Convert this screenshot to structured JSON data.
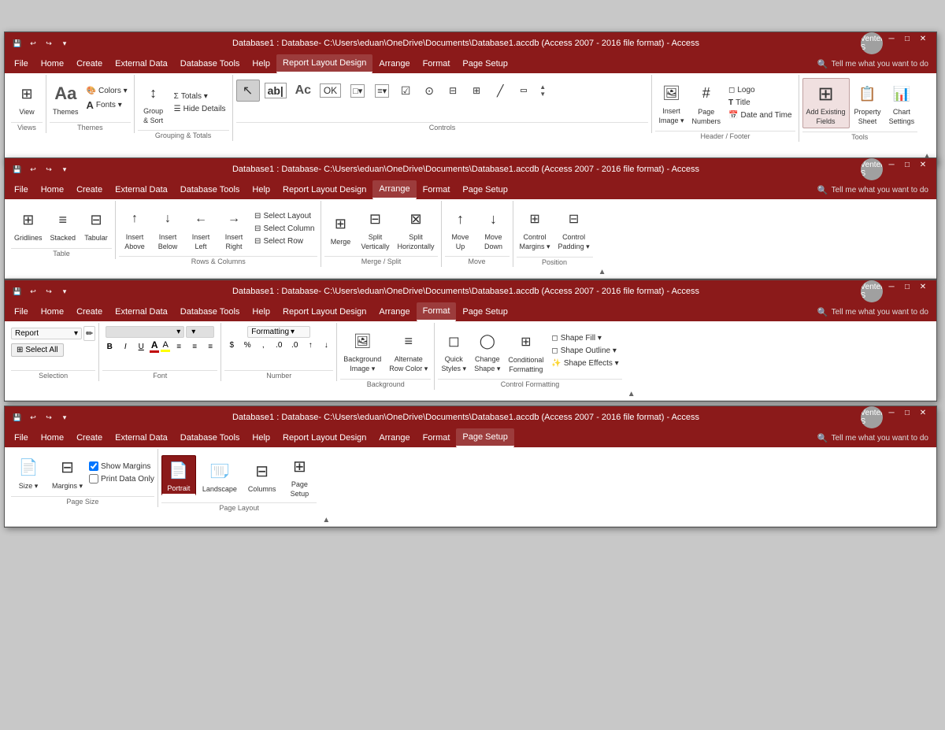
{
  "windows": [
    {
      "id": "window1",
      "title": "Database1 : Database- C:\\Users\\eduan\\OneDrive\\Documents\\Database1.accdb (Access 2007 - 2016 file format) - Access",
      "active_tab": "Report Layout Design",
      "tabs": [
        "File",
        "Home",
        "Create",
        "External Data",
        "Database Tools",
        "Help",
        "Report Layout Design",
        "Arrange",
        "Format",
        "Page Setup"
      ],
      "ribbon_name": "Report Layout Design",
      "sections": [
        {
          "name": "Views",
          "items": [
            {
              "label": "View",
              "icon": "⊞"
            }
          ]
        },
        {
          "name": "Themes",
          "items": [
            {
              "label": "Themes",
              "icon": "Aa"
            },
            {
              "label": "Colors",
              "icon": "🎨"
            },
            {
              "label": "Fonts",
              "icon": "A"
            }
          ]
        },
        {
          "name": "Grouping & Totals",
          "items": [
            {
              "label": "Group & Sort",
              "icon": "↕"
            },
            {
              "label": "Totals",
              "icon": "Σ"
            },
            {
              "label": "Hide Details",
              "icon": "≡"
            }
          ]
        },
        {
          "name": "Controls",
          "items": []
        },
        {
          "name": "Header / Footer",
          "items": [
            {
              "label": "Insert Image",
              "icon": "🖼"
            },
            {
              "label": "Page Numbers",
              "icon": "#"
            },
            {
              "label": "Logo",
              "icon": "◻"
            },
            {
              "label": "Title",
              "icon": "T"
            },
            {
              "label": "Date and Time",
              "icon": "📅"
            }
          ]
        },
        {
          "name": "Tools",
          "items": [
            {
              "label": "Add Existing Fields",
              "icon": "⊞"
            },
            {
              "label": "Property Sheet",
              "icon": "📋"
            },
            {
              "label": "Chart Settings",
              "icon": "📊"
            }
          ]
        }
      ]
    },
    {
      "id": "window2",
      "title": "Database1 : Database- C:\\Users\\eduan\\OneDrive\\Documents\\Database1.accdb (Access 2007 - 2016 file format) - Access",
      "active_tab": "Arrange",
      "tabs": [
        "File",
        "Home",
        "Create",
        "External Data",
        "Database Tools",
        "Help",
        "Report Layout Design",
        "Arrange",
        "Format",
        "Page Setup"
      ],
      "ribbon_name": "Arrange",
      "sections": [
        {
          "name": "Table",
          "items": [
            {
              "label": "Gridlines",
              "icon": "⊞"
            },
            {
              "label": "Stacked",
              "icon": "≡"
            },
            {
              "label": "Tabular",
              "icon": "⊟"
            }
          ]
        },
        {
          "name": "Rows & Columns",
          "items": [
            {
              "label": "Insert Above",
              "icon": "↑"
            },
            {
              "label": "Insert Below",
              "icon": "↓"
            },
            {
              "label": "Insert Left",
              "icon": "←"
            },
            {
              "label": "Insert Right",
              "icon": "→"
            },
            {
              "label": "Select Layout",
              "icon": ""
            },
            {
              "label": "Select Column",
              "icon": ""
            },
            {
              "label": "Select Row",
              "icon": ""
            }
          ]
        },
        {
          "name": "Merge / Split",
          "items": [
            {
              "label": "Merge",
              "icon": "⊞"
            },
            {
              "label": "Split Vertically",
              "icon": "⊟"
            },
            {
              "label": "Split Horizontally",
              "icon": "⊠"
            }
          ]
        },
        {
          "name": "Move",
          "items": [
            {
              "label": "Move Up",
              "icon": "↑"
            },
            {
              "label": "Move Down",
              "icon": "↓"
            }
          ]
        },
        {
          "name": "Position",
          "items": [
            {
              "label": "Control Margins",
              "icon": "⊞"
            },
            {
              "label": "Control Padding",
              "icon": "⊟"
            }
          ]
        }
      ]
    },
    {
      "id": "window3",
      "title": "Database1 : Database- C:\\Users\\eduan\\OneDrive\\Documents\\Database1.accdb (Access 2007 - 2016 file format) - Access",
      "active_tab": "Format",
      "tabs": [
        "File",
        "Home",
        "Create",
        "External Data",
        "Database Tools",
        "Help",
        "Report Layout Design",
        "Arrange",
        "Format",
        "Page Setup"
      ],
      "ribbon_name": "Format",
      "sections": [
        {
          "name": "Selection",
          "items": [
            {
              "label": "Report",
              "dropdown": true
            },
            {
              "label": "Select All",
              "icon": "⊞"
            }
          ]
        },
        {
          "name": "Font",
          "items": [
            {
              "label": "B",
              "bold": true
            },
            {
              "label": "I",
              "italic": true
            },
            {
              "label": "U",
              "underline": true
            },
            {
              "label": "Font Color",
              "icon": "A"
            },
            {
              "label": "Highlight",
              "icon": "✏"
            }
          ]
        },
        {
          "name": "Number",
          "items": []
        },
        {
          "name": "Background",
          "items": [
            {
              "label": "Background Image",
              "icon": "🖼"
            },
            {
              "label": "Alternate Row Color",
              "icon": "🎨"
            }
          ]
        },
        {
          "name": "Control Formatting",
          "items": [
            {
              "label": "Quick Styles",
              "icon": "◻"
            },
            {
              "label": "Change Shape",
              "icon": "◯"
            },
            {
              "label": "Conditional Formatting",
              "icon": "⊞"
            },
            {
              "label": "Shape Fill",
              "icon": "◻"
            },
            {
              "label": "Shape Outline",
              "icon": "◻"
            },
            {
              "label": "Shape Effects",
              "icon": "✨"
            }
          ]
        }
      ]
    },
    {
      "id": "window4",
      "title": "Database1 : Database- C:\\Users\\eduan\\OneDrive\\Documents\\Database1.accdb (Access 2007 - 2016 file format) - Access",
      "active_tab": "Page Setup",
      "tabs": [
        "File",
        "Home",
        "Create",
        "External Data",
        "Database Tools",
        "Help",
        "Report Layout Design",
        "Arrange",
        "Format",
        "Page Setup"
      ],
      "ribbon_name": "Page Setup",
      "sections": [
        {
          "name": "Page Size",
          "items": [
            {
              "label": "Size",
              "icon": "📄"
            },
            {
              "label": "Margins",
              "icon": "⊟"
            },
            {
              "label": "Show Margins",
              "checkbox": true
            },
            {
              "label": "Print Data Only",
              "checkbox": true
            }
          ]
        },
        {
          "name": "Page Layout",
          "items": [
            {
              "label": "Portrait",
              "icon": "📄",
              "active": true
            },
            {
              "label": "Landscape",
              "icon": "📄"
            },
            {
              "label": "Columns",
              "icon": "⊟"
            },
            {
              "label": "Page Setup",
              "icon": "⊞"
            }
          ]
        }
      ]
    }
  ],
  "user": "Venter S",
  "tell_me": "Tell me what you want to do",
  "colors": {
    "title_bar": "#8b1a1a",
    "menu_bar": "#8b1a1a",
    "ribbon_bg": "#ffffff",
    "active_tab_bg": "#ffffff",
    "active_tab_color": "#8b1a1a",
    "window_bg": "#f0f0f0"
  }
}
